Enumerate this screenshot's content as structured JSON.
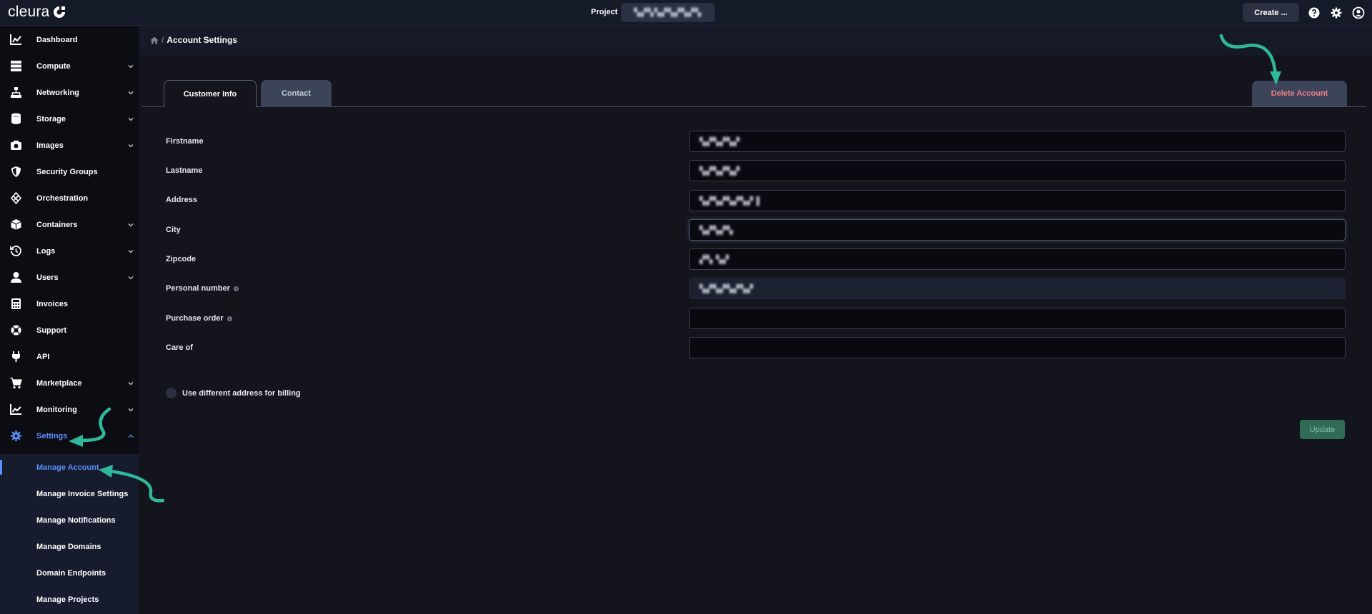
{
  "app": {
    "logo_text": "cleura",
    "project_label": "Project",
    "project_value": "▚▞▚▚▞▚▞▚▞▚",
    "create_label": "Create ..."
  },
  "topbar_icons": [
    "help-icon",
    "settings-gear-icon",
    "user-account-icon"
  ],
  "sidebar": {
    "items": [
      {
        "label": "Dashboard",
        "icon": "chart-icon",
        "has_chevron": false
      },
      {
        "label": "Compute",
        "icon": "server-icon",
        "has_chevron": true
      },
      {
        "label": "Networking",
        "icon": "network-icon",
        "has_chevron": true
      },
      {
        "label": "Storage",
        "icon": "database-icon",
        "has_chevron": true
      },
      {
        "label": "Images",
        "icon": "camera-icon",
        "has_chevron": true
      },
      {
        "label": "Security Groups",
        "icon": "shield-icon",
        "has_chevron": false
      },
      {
        "label": "Orchestration",
        "icon": "orchestration-icon",
        "has_chevron": false
      },
      {
        "label": "Containers",
        "icon": "cube-icon",
        "has_chevron": true
      },
      {
        "label": "Logs",
        "icon": "history-icon",
        "has_chevron": true
      },
      {
        "label": "Users",
        "icon": "user-icon",
        "has_chevron": true
      },
      {
        "label": "Invoices",
        "icon": "calculator-icon",
        "has_chevron": false
      },
      {
        "label": "Support",
        "icon": "lifebuoy-icon",
        "has_chevron": false
      },
      {
        "label": "API",
        "icon": "plug-icon",
        "has_chevron": false
      },
      {
        "label": "Marketplace",
        "icon": "cart-icon",
        "has_chevron": true
      },
      {
        "label": "Monitoring",
        "icon": "trend-icon",
        "has_chevron": true
      },
      {
        "label": "Settings",
        "icon": "cog-icon",
        "has_chevron": true,
        "active": true
      }
    ],
    "settings_submenu": [
      {
        "label": "Manage Account",
        "active": true
      },
      {
        "label": "Manage Invoice Settings"
      },
      {
        "label": "Manage Notifications"
      },
      {
        "label": "Manage Domains"
      },
      {
        "label": "Domain Endpoints"
      },
      {
        "label": "Manage Projects"
      }
    ]
  },
  "breadcrumb": {
    "separator": "/",
    "current": "Account Settings"
  },
  "tabs": {
    "customer_info": "Customer Info",
    "contact": "Contact",
    "active": "Customer Info"
  },
  "delete_account_label": "Delete Account",
  "form": {
    "fields": [
      {
        "label": "Firstname",
        "value": "▚▞▚▞▚▞",
        "info": false
      },
      {
        "label": "Lastname",
        "value": "▚▞▚▞▚▞",
        "info": false
      },
      {
        "label": "Address",
        "value": "▚▞▚▞▚▞▚▞ ▌",
        "info": false
      },
      {
        "label": "City",
        "value": "▚▞▚▞▚",
        "info": false,
        "focused": true
      },
      {
        "label": "Zipcode",
        "value": "▞▚ ▚▞",
        "info": false
      },
      {
        "label": "Personal number",
        "value": "▚▞▚▞▚▞▚▞",
        "info": true,
        "readonly": true
      },
      {
        "label": "Purchase order",
        "value": "",
        "info": true
      },
      {
        "label": "Care of",
        "value": "",
        "info": false
      }
    ],
    "billing_toggle_label": "Use different address for billing",
    "update_label": "Update"
  },
  "colors": {
    "accent": "#5b8ff9",
    "danger_text": "#f07f86",
    "annotation_arrow": "#2fb89a",
    "update_bg": "#2f6b57"
  }
}
